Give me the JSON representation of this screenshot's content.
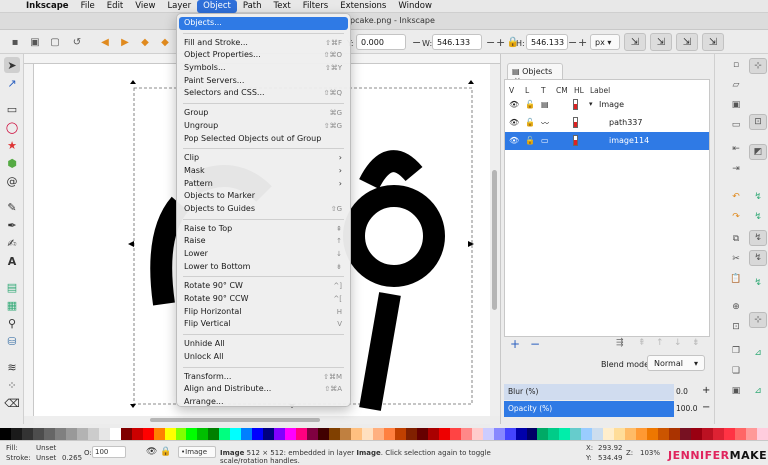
{
  "menubar": {
    "apple": "",
    "items": [
      "Inkscape",
      "File",
      "Edit",
      "View",
      "Layer",
      "Object",
      "Path",
      "Text",
      "Filters",
      "Extensions",
      "Window"
    ]
  },
  "window_title": "pcake.png - Inkscape",
  "toolbar": {
    "y_label": "Y:",
    "y_value": "0.000",
    "w_label": "W:",
    "w_value": "546.133",
    "h_label": "H:",
    "h_value": "546.133",
    "unit": "px",
    "minus": "−",
    "plus": "+"
  },
  "object_menu": {
    "items": [
      {
        "label": "Objects...",
        "shortcut": "",
        "highlighted": true
      },
      {
        "sep": true
      },
      {
        "label": "Fill and Stroke...",
        "shortcut": "⇧⌘F"
      },
      {
        "label": "Object Properties...",
        "shortcut": "⇧⌘O"
      },
      {
        "label": "Symbols...",
        "shortcut": "⇧⌘Y"
      },
      {
        "label": "Paint Servers...",
        "shortcut": ""
      },
      {
        "label": "Selectors and CSS...",
        "shortcut": "⇧⌘Q"
      },
      {
        "sep": true
      },
      {
        "label": "Group",
        "shortcut": "⌘G"
      },
      {
        "label": "Ungroup",
        "shortcut": "⇧⌘G"
      },
      {
        "label": "Pop Selected Objects out of Group",
        "shortcut": ""
      },
      {
        "sep": true
      },
      {
        "label": "Clip",
        "shortcut": "",
        "submenu": true
      },
      {
        "label": "Mask",
        "shortcut": "",
        "submenu": true
      },
      {
        "label": "Pattern",
        "shortcut": "",
        "submenu": true
      },
      {
        "label": "Objects to Marker",
        "shortcut": ""
      },
      {
        "label": "Objects to Guides",
        "shortcut": "⇧G"
      },
      {
        "sep": true
      },
      {
        "label": "Raise to Top",
        "shortcut": "⇞"
      },
      {
        "label": "Raise",
        "shortcut": "↑"
      },
      {
        "label": "Lower",
        "shortcut": "↓"
      },
      {
        "label": "Lower to Bottom",
        "shortcut": "⇟"
      },
      {
        "sep": true
      },
      {
        "label": "Rotate 90° CW",
        "shortcut": "^]"
      },
      {
        "label": "Rotate 90° CCW",
        "shortcut": "^["
      },
      {
        "label": "Flip Horizontal",
        "shortcut": "H"
      },
      {
        "label": "Flip Vertical",
        "shortcut": "V"
      },
      {
        "sep": true
      },
      {
        "label": "Unhide All",
        "shortcut": ""
      },
      {
        "label": "Unlock All",
        "shortcut": ""
      },
      {
        "sep": true
      },
      {
        "label": "Transform...",
        "shortcut": "⇧⌘M"
      },
      {
        "label": "Align and Distribute...",
        "shortcut": "⇧⌘A"
      },
      {
        "label": "Arrange...",
        "shortcut": ""
      }
    ]
  },
  "objects_panel": {
    "tab_label": "Objects",
    "tab_close": "✕",
    "columns": [
      "V",
      "L",
      "T",
      "CM",
      "HL",
      "Label"
    ],
    "rows": [
      {
        "label": "Image",
        "selected": false,
        "expander": "▾"
      },
      {
        "label": "path337",
        "selected": false
      },
      {
        "label": "image114",
        "selected": true
      }
    ],
    "add": "+",
    "remove": "−",
    "blend_label": "Blend mode:",
    "blend_value": "Normal",
    "blur_label": "Blur (%)",
    "blur_value": "0.0",
    "opacity_label": "Opacity (%)",
    "opacity_value": "100.0"
  },
  "status": {
    "fill_label": "Fill:",
    "fill_value": "Unset",
    "stroke_label": "Stroke:",
    "stroke_value": "Unset",
    "stroke_width": "0.265",
    "o_label": "O:",
    "o_value": "100",
    "layer": "•Image",
    "message_bold": "Image",
    "message": " 512 × 512: embedded in layer ",
    "message_layer": "Image",
    "message_tail": ". Click selection again to toggle scale/rotation handles.",
    "x_label": "X:",
    "x_value": "293.92",
    "y_label": "Y:",
    "y_value": "534.49",
    "z_label": "Z:",
    "zoom": "103%",
    "brand_a": "JENNIFER",
    "brand_b": "MAKER"
  },
  "colors": {
    "accent": "#2f7ae5",
    "brand": "#e0245e"
  }
}
